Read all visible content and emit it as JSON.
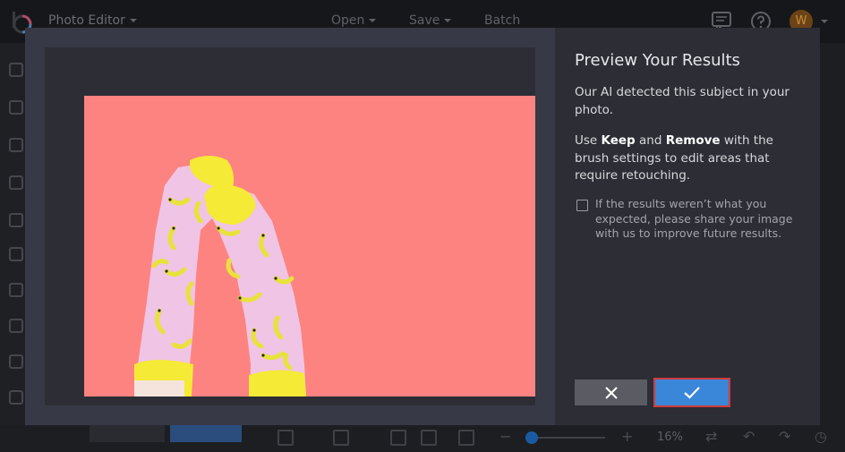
{
  "app": {
    "title": "Photo Editor",
    "user_initial": "W"
  },
  "nav": {
    "open_label": "Open",
    "save_label": "Save",
    "batch_label": "Batch"
  },
  "modal": {
    "title": "Preview Your Results",
    "intro": "Our AI detected this subject in your photo.",
    "instructions": {
      "prefix": "Use ",
      "keep": "Keep",
      "middle": " and ",
      "remove": "Remove",
      "suffix": " with the brush settings to edit areas that require retouching."
    },
    "feedback_text": "If the results weren’t what you expected, please share your image with us to improve future results.",
    "feedback_checked": false,
    "photo_bg_color": "#fd8381",
    "sock_color": "#f0c4e4",
    "banana_color": "#e8e23a",
    "cuff_color": "#f5ea35"
  },
  "toolbar": {
    "zoom_text": "16%"
  },
  "colors": {
    "accent": "#3a86d9",
    "highlight_border": "#d13b3b"
  }
}
